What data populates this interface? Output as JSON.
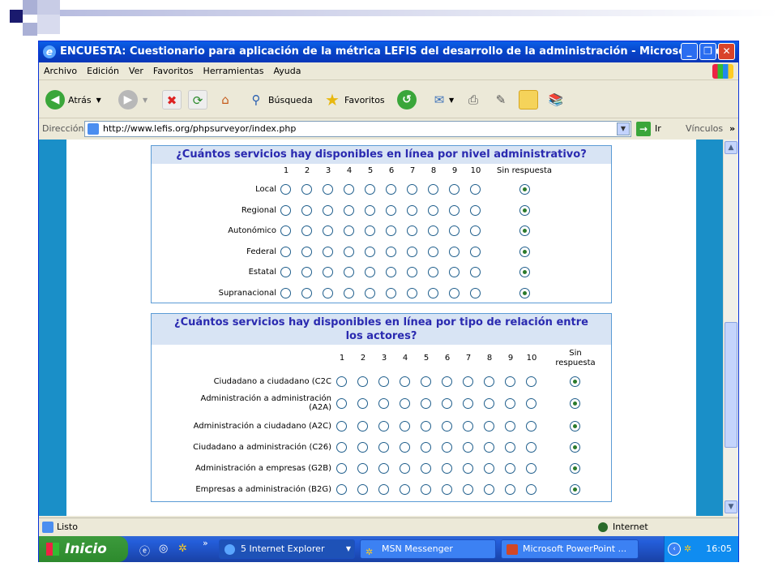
{
  "window": {
    "title": "ENCUESTA: Cuestionario para aplicación de la métrica LEFIS del desarrollo de la administración - Microsoft Inte...",
    "menu": [
      "Archivo",
      "Edición",
      "Ver",
      "Favoritos",
      "Herramientas",
      "Ayuda"
    ],
    "toolbar": {
      "back_label": "Atrás",
      "search_label": "Búsqueda",
      "favorites_label": "Favoritos"
    },
    "address": {
      "label": "Dirección",
      "url": "http://www.lefis.org/phpsurveyor/index.php",
      "go_label": "Ir",
      "links_label": "Vínculos"
    },
    "status": {
      "text": "Listo",
      "zone": "Internet"
    }
  },
  "q1": {
    "title": "¿Cuántos servicios hay disponibles en línea por nivel administrativo?",
    "columns": [
      "1",
      "2",
      "3",
      "4",
      "5",
      "6",
      "7",
      "8",
      "9",
      "10",
      "Sin respuesta"
    ],
    "rows": [
      "Local",
      "Regional",
      "Autonómico",
      "Federal",
      "Estatal",
      "Supranacional"
    ],
    "selected": "Sin respuesta"
  },
  "q2": {
    "title_line1": "¿Cuántos servicios hay disponibles en línea por tipo de relación entre",
    "title_line2": "los actores?",
    "columns": [
      "1",
      "2",
      "3",
      "4",
      "5",
      "6",
      "7",
      "8",
      "9",
      "10"
    ],
    "no_answer_line1": "Sin",
    "no_answer_line2": "respuesta",
    "rows": [
      [
        "Ciudadano a ciudadano (C2C",
        ""
      ],
      [
        "Administración a administración",
        "(A2A)"
      ],
      [
        "Administración a ciudadano (A2C)",
        ""
      ],
      [
        "Ciudadano a administración (C26)",
        ""
      ],
      [
        "Administración a empresas (G2B)",
        ""
      ],
      [
        "Empresas a administración (B2G)",
        ""
      ]
    ],
    "selected": "Sin respuesta"
  },
  "taskbar": {
    "start_label": "Inicio",
    "tasks": [
      "5 Internet Explorer",
      "MSN Messenger",
      "Microsoft PowerPoint ..."
    ],
    "clock": "16:05"
  }
}
